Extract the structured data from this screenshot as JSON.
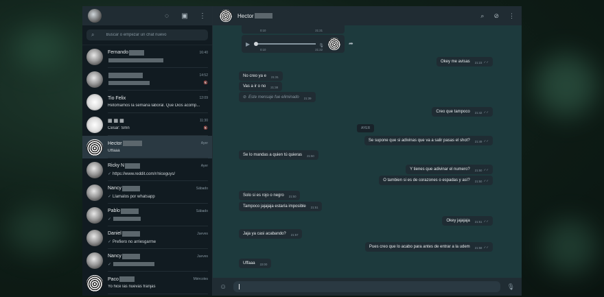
{
  "sidebar": {
    "search_placeholder": "Buscar o empezar un chat nuevo",
    "chats": [
      {
        "name": "Fernando",
        "time": "16:40",
        "preview": ""
      },
      {
        "name": "",
        "time": "14:52",
        "preview": ""
      },
      {
        "name": "Tio Felix",
        "time": "12:09",
        "preview": "Retomamos la semana laboral. Que Dios acomp..."
      },
      {
        "name": "",
        "time": "11:30",
        "preview": "Cesar: Smn"
      },
      {
        "name": "Hector",
        "time": "Ayer",
        "preview": "Uffaaa"
      },
      {
        "name": "Ricky N",
        "time": "Ayer",
        "preview": "https://www.reddit.com/r/niceguys/"
      },
      {
        "name": "Nancy",
        "time": "Sábado",
        "preview": "Llamalos por whatsapp"
      },
      {
        "name": "Pablo",
        "time": "Sábado",
        "preview": ""
      },
      {
        "name": "Daniel",
        "time": "Jueves",
        "preview": "Prefiero no arriesgarme"
      },
      {
        "name": "Nancy",
        "time": "Jueves",
        "preview": ""
      },
      {
        "name": "Paco",
        "time": "Miércoles",
        "preview": "Yo hice las nuevas franjas"
      }
    ]
  },
  "conversation": {
    "contact_name": "Hector",
    "day_separator": "AYER",
    "audio1": {
      "duration": "0:10",
      "time": "21:21"
    },
    "audio2": {
      "duration": "0:10",
      "time": "21:22"
    },
    "messages": [
      {
        "dir": "out",
        "text": "Okey me avisas",
        "time": "21:23"
      },
      {
        "dir": "in",
        "text": "No creo ya e",
        "time": "21:31"
      },
      {
        "dir": "in",
        "text": "Vas a ir o no",
        "time": "21:38"
      },
      {
        "dir": "in",
        "text": "Este mensaje fue eliminado",
        "time": "21:39",
        "deleted": true
      },
      {
        "dir": "out",
        "text": "Creo que tampoco",
        "time": "21:42"
      },
      {
        "dir": "out",
        "text": "Se supone que si adivinas que va a salir pasas el shot?",
        "time": "21:49"
      },
      {
        "dir": "in",
        "text": "Se lo mandas a quien tú quieras",
        "time": "21:50"
      },
      {
        "dir": "out",
        "text": "Y tienes que adivinar el numero?",
        "time": "21:50"
      },
      {
        "dir": "out",
        "text": "O tambien si es de corazones o espadas y así?",
        "time": "21:50"
      },
      {
        "dir": "in",
        "text": "Solo si es rojo o negro",
        "time": "21:50"
      },
      {
        "dir": "in",
        "text": "Tampoco jajajaja estaría imposible",
        "time": "21:51"
      },
      {
        "dir": "out",
        "text": "Okey jajajaja",
        "time": "21:51"
      },
      {
        "dir": "in",
        "text": "Jaja ya casi acabando?",
        "time": "21:57"
      },
      {
        "dir": "out",
        "text": "Pues creo que lo acabo para antes de entrar a la udem",
        "time": "21:58"
      },
      {
        "dir": "in",
        "text": "Uffaaa",
        "time": "22:00"
      }
    ]
  }
}
